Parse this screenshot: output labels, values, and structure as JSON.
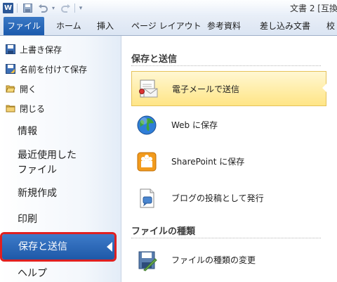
{
  "titlebar": {
    "app_icon": "W",
    "document_title": "文書 2 [互換"
  },
  "quick_access": {
    "save_icon": "save-icon",
    "undo_icon": "undo-icon",
    "redo_icon": "redo-icon",
    "customize_icon": "customize-qat-icon"
  },
  "ribbon_tabs": [
    {
      "label": "ファイル"
    },
    {
      "label": "ホーム"
    },
    {
      "label": "挿入"
    },
    {
      "label": "ページ レイアウト"
    },
    {
      "label": "参考資料"
    },
    {
      "label": "差し込み文書"
    },
    {
      "label": "校"
    }
  ],
  "backstage": {
    "commands": [
      {
        "label": "上書き保存",
        "icon": "save-icon"
      },
      {
        "label": "名前を付けて保存",
        "icon": "save-as-icon"
      },
      {
        "label": "開く",
        "icon": "open-folder-icon"
      },
      {
        "label": "閉じる",
        "icon": "close-folder-icon"
      }
    ],
    "nav": [
      {
        "label": "情報"
      },
      {
        "label": "最近使用した"
      },
      {
        "label": "ファイル"
      },
      {
        "label": "新規作成"
      },
      {
        "label": "印刷"
      },
      {
        "label": "保存と送信"
      },
      {
        "label": "ヘルプ"
      }
    ]
  },
  "save_send": {
    "section1_title": "保存と送信",
    "options": [
      {
        "label": "電子メールで送信",
        "icon": "email-icon",
        "selected": true
      },
      {
        "label": "Web に保存",
        "icon": "globe-icon",
        "selected": false
      },
      {
        "label": "SharePoint に保存",
        "icon": "sharepoint-icon",
        "selected": false
      },
      {
        "label": "ブログの投稿として発行",
        "icon": "blog-icon",
        "selected": false
      }
    ],
    "section2_title": "ファイルの種類",
    "file_type_options": [
      {
        "label": "ファイルの種類の変更",
        "icon": "change-file-type-icon"
      }
    ]
  },
  "colors": {
    "file_tab": "#2a67b7",
    "active_nav": "#2a67b7",
    "highlight_border": "#e02020",
    "selected_option": "#ffe586"
  }
}
